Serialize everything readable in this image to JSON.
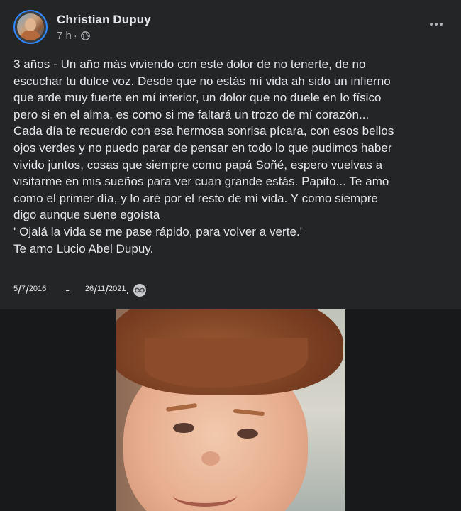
{
  "post": {
    "author": "Christian Dupuy",
    "time": "7 h",
    "separator": "·",
    "lines": [
      "3 años - Un año más viviendo con este dolor de no tenerte, de no",
      "escuchar tu dulce voz. Desde que no estás mí vida ah sido un infierno",
      "que arde muy fuerte en mí interior, un dolor que no duele en lo físico",
      "pero si en el alma, es como si me faltará un trozo de mí corazón...",
      "Cada día te recuerdo con esa hermosa sonrisa pícara, con esos bellos",
      "ojos verdes y no puedo parar de pensar en todo lo que pudimos haber",
      "vivido juntos,  cosas que siempre como papá Soñé, espero vuelvas a",
      "visitarme en mis sueños para ver cuan grande estás. Papito... Te amo",
      "como el primer día, y lo aré por el resto de mí vida. Y como siempre",
      "digo aunque suene egoísta",
      "' Ojalá la vida se me pase rápido, para volver a verte.'",
      "Te amo Lucio Abel Dupuy."
    ],
    "date_start": {
      "day": "5",
      "month": "7",
      "year": "2016"
    },
    "dash": "-",
    "date_end": {
      "day": "26",
      "month": "11",
      "year": "2021"
    },
    "period": "."
  },
  "icons": {
    "privacy": "globe-icon",
    "menu": "more-options-icon",
    "emoji": "infinity-icon"
  },
  "colors": {
    "card_bg": "#242526",
    "page_bg": "#18191a",
    "text_primary": "#e4e6eb",
    "text_secondary": "#b0b3b8"
  }
}
